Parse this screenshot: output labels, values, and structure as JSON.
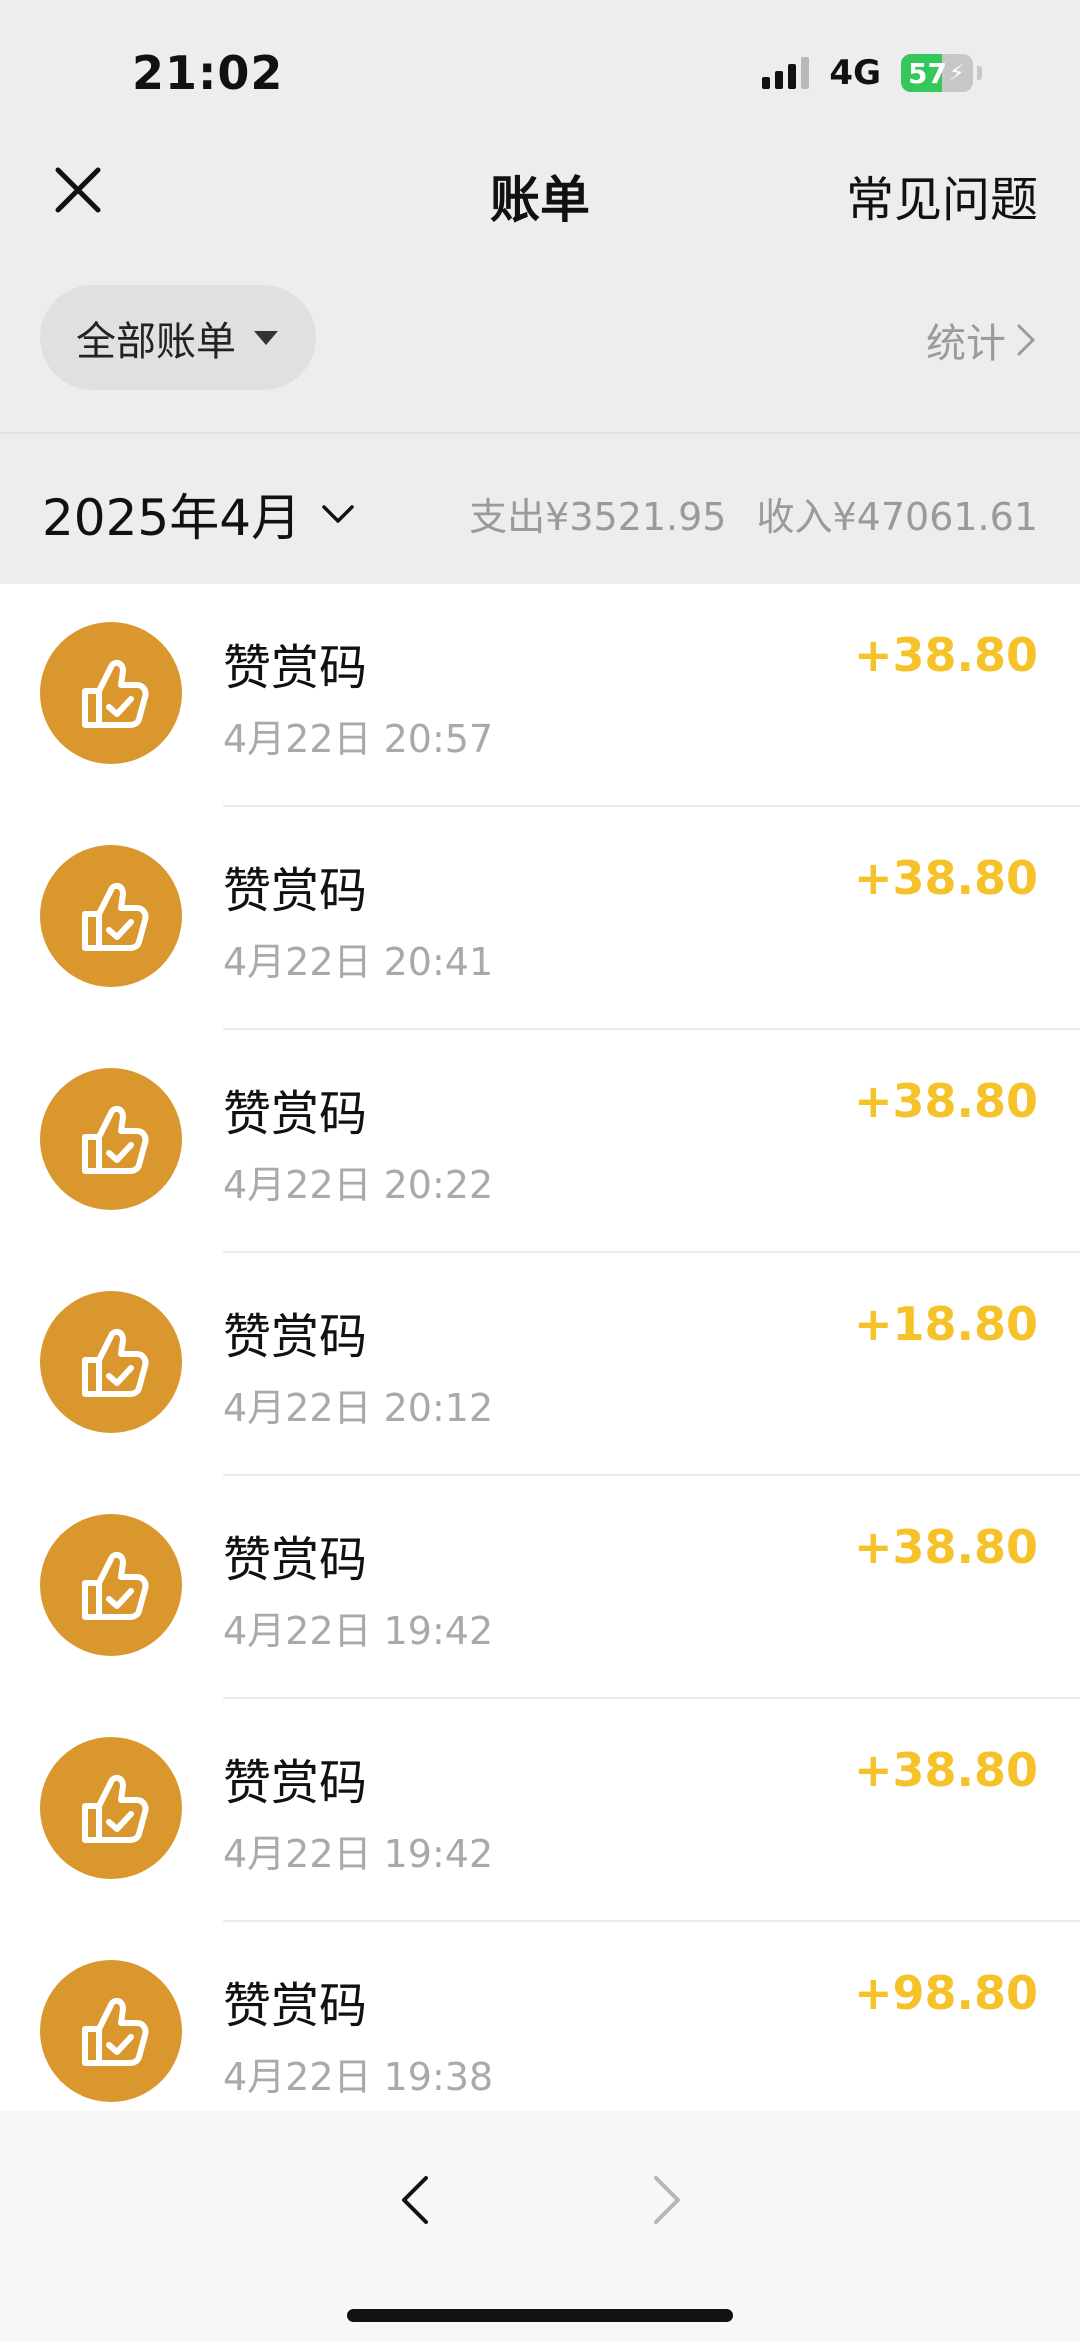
{
  "status_bar": {
    "time": "21:02",
    "network": "4G",
    "battery_level": "57",
    "battery_fraction": 0.57,
    "battery_color": "#34c759"
  },
  "nav": {
    "close_icon": "close-icon",
    "title": "账单",
    "faq": "常见问题"
  },
  "filter": {
    "label": "全部账单",
    "stats": "统计"
  },
  "month": {
    "label": "2025年4月",
    "expense": "支出¥3521.95",
    "income": "收入¥47061.61"
  },
  "transactions": [
    {
      "title": "赞赏码",
      "time": "4月22日 20:57",
      "amount": "+38.80",
      "icon": "thumbs-up-check-icon"
    },
    {
      "title": "赞赏码",
      "time": "4月22日 20:41",
      "amount": "+38.80",
      "icon": "thumbs-up-check-icon"
    },
    {
      "title": "赞赏码",
      "time": "4月22日 20:22",
      "amount": "+38.80",
      "icon": "thumbs-up-check-icon"
    },
    {
      "title": "赞赏码",
      "time": "4月22日 20:12",
      "amount": "+18.80",
      "icon": "thumbs-up-check-icon"
    },
    {
      "title": "赞赏码",
      "time": "4月22日 19:42",
      "amount": "+38.80",
      "icon": "thumbs-up-check-icon"
    },
    {
      "title": "赞赏码",
      "time": "4月22日 19:42",
      "amount": "+38.80",
      "icon": "thumbs-up-check-icon"
    },
    {
      "title": "赞赏码",
      "time": "4月22日 19:38",
      "amount": "+98.80",
      "icon": "thumbs-up-check-icon"
    }
  ],
  "colors": {
    "accent_income": "#f6c22a",
    "icon_bg": "#d9972e",
    "background": "#ededed"
  }
}
